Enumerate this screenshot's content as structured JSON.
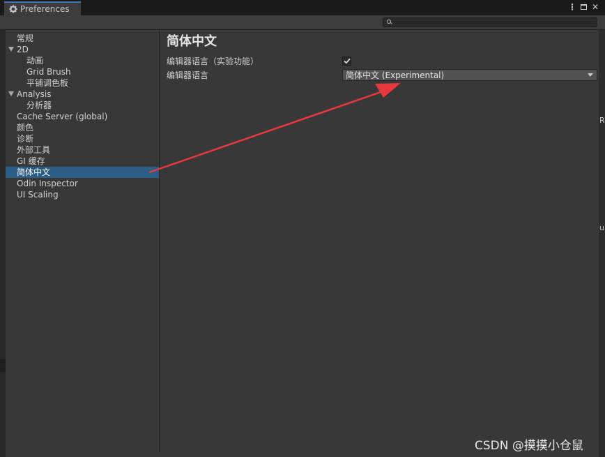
{
  "window": {
    "tab_title": "Preferences",
    "search": {
      "value": "",
      "placeholder": ""
    }
  },
  "sidebar": {
    "items": [
      {
        "label": "常规",
        "level": 0,
        "foldout": false,
        "selected": false
      },
      {
        "label": "2D",
        "level": 0,
        "foldout": true,
        "selected": false
      },
      {
        "label": "动画",
        "level": 1,
        "foldout": false,
        "selected": false
      },
      {
        "label": "Grid Brush",
        "level": 1,
        "foldout": false,
        "selected": false
      },
      {
        "label": "平铺调色板",
        "level": 1,
        "foldout": false,
        "selected": false
      },
      {
        "label": "Analysis",
        "level": 0,
        "foldout": true,
        "selected": false
      },
      {
        "label": "分析器",
        "level": 1,
        "foldout": false,
        "selected": false
      },
      {
        "label": "Cache Server (global)",
        "level": 0,
        "foldout": false,
        "selected": false
      },
      {
        "label": "颜色",
        "level": 0,
        "foldout": false,
        "selected": false
      },
      {
        "label": "诊断",
        "level": 0,
        "foldout": false,
        "selected": false
      },
      {
        "label": "外部工具",
        "level": 0,
        "foldout": false,
        "selected": false
      },
      {
        "label": "GI 缓存",
        "level": 0,
        "foldout": false,
        "selected": false
      },
      {
        "label": "简体中文",
        "level": 0,
        "foldout": false,
        "selected": true
      },
      {
        "label": "Odin Inspector",
        "level": 0,
        "foldout": false,
        "selected": false
      },
      {
        "label": "UI Scaling",
        "level": 0,
        "foldout": false,
        "selected": false
      }
    ]
  },
  "main": {
    "title": "简体中文",
    "rows": [
      {
        "label": "编辑器语言（实验功能）",
        "type": "checkbox",
        "checked": true
      },
      {
        "label": "编辑器语言",
        "type": "dropdown",
        "value": "简体中文 (Experimental)"
      }
    ]
  },
  "edge_glyphs": [
    "R",
    "u"
  ],
  "watermark": "CSDN @摸摸小仓鼠",
  "colors": {
    "selection": "#2c5d87",
    "tab_accent": "#3a79bb",
    "annotation_arrow": "#e8383d"
  }
}
